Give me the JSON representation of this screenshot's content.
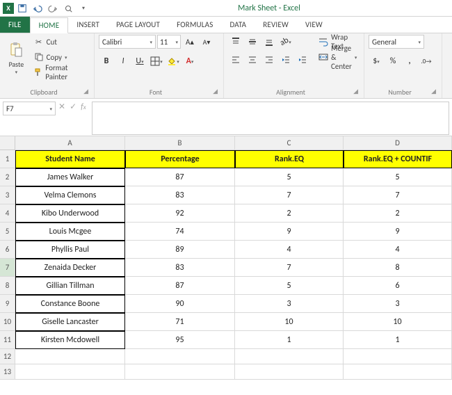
{
  "titlebar": {
    "app_glyph": "X",
    "title": "Mark Sheet - Excel"
  },
  "tabs": {
    "file": "FILE",
    "home": "HOME",
    "insert": "INSERT",
    "page_layout": "PAGE LAYOUT",
    "formulas": "FORMULAS",
    "data": "DATA",
    "review": "REVIEW",
    "view": "VIEW"
  },
  "ribbon": {
    "clipboard": {
      "paste": "Paste",
      "cut": "Cut",
      "copy": "Copy",
      "format_painter": "Format Painter",
      "label": "Clipboard"
    },
    "font": {
      "name": "Calibri",
      "size": "11",
      "label": "Font"
    },
    "alignment": {
      "wrap": "Wrap Text",
      "merge": "Merge & Center",
      "label": "Alignment"
    },
    "number": {
      "format": "General",
      "label": "Number"
    }
  },
  "namebox": "F7",
  "columns": [
    "A",
    "B",
    "C",
    "D"
  ],
  "row_numbers": [
    "1",
    "2",
    "3",
    "4",
    "5",
    "6",
    "7",
    "8",
    "9",
    "10",
    "11",
    "12",
    "13"
  ],
  "headers": [
    "Student Name",
    "Percentage",
    "Rank.EQ",
    "Rank.EQ + COUNTIF"
  ],
  "rows": [
    {
      "name": "James Walker",
      "pct": "87",
      "rank": "5",
      "rankc": "5"
    },
    {
      "name": "Velma Clemons",
      "pct": "83",
      "rank": "7",
      "rankc": "7"
    },
    {
      "name": "Kibo Underwood",
      "pct": "92",
      "rank": "2",
      "rankc": "2"
    },
    {
      "name": "Louis Mcgee",
      "pct": "74",
      "rank": "9",
      "rankc": "9"
    },
    {
      "name": "Phyllis Paul",
      "pct": "89",
      "rank": "4",
      "rankc": "4"
    },
    {
      "name": "Zenaida Decker",
      "pct": "83",
      "rank": "7",
      "rankc": "8"
    },
    {
      "name": "Gillian Tillman",
      "pct": "87",
      "rank": "5",
      "rankc": "6"
    },
    {
      "name": "Constance Boone",
      "pct": "90",
      "rank": "3",
      "rankc": "3"
    },
    {
      "name": "Giselle Lancaster",
      "pct": "71",
      "rank": "10",
      "rankc": "10"
    },
    {
      "name": "Kirsten Mcdowell",
      "pct": "95",
      "rank": "1",
      "rankc": "1"
    }
  ],
  "selected_row": 7
}
